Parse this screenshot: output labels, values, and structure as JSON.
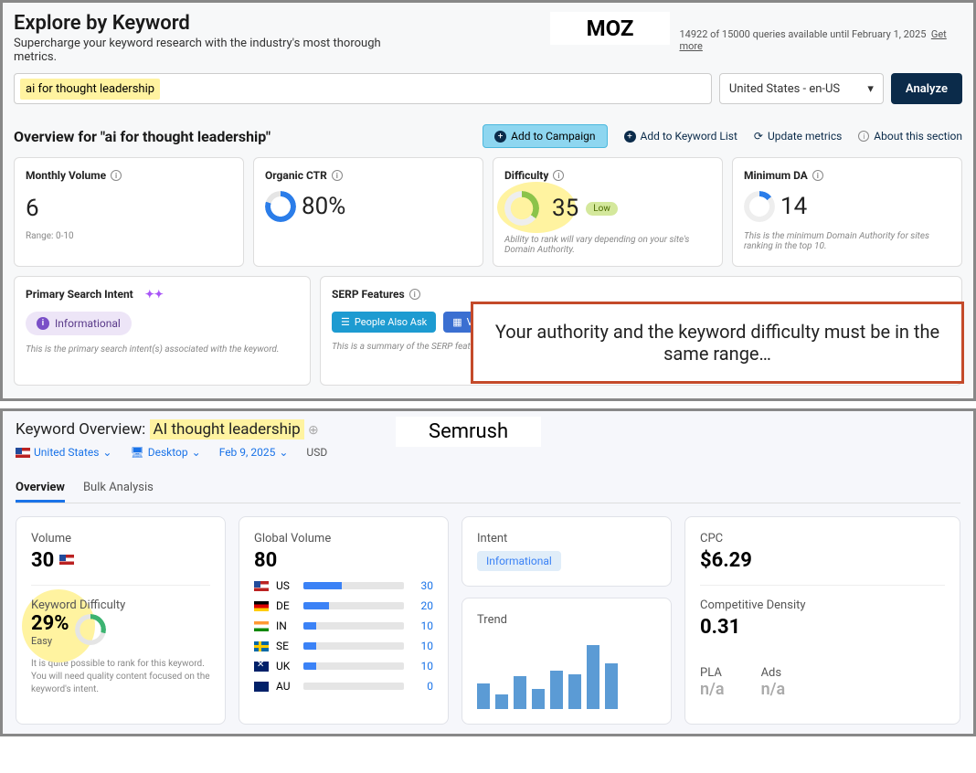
{
  "moz": {
    "title": "Explore by Keyword",
    "subtitle": "Supercharge your keyword research with the industry's most thorough metrics.",
    "brand": "MOZ",
    "quota": "14922 of 15000 queries available until February 1, 2025",
    "quota_link": "Get more",
    "search_value": "ai for thought leadership",
    "locale": "United States - en-US",
    "analyze": "Analyze",
    "overview_title": "Overview for \"ai for thought leadership\"",
    "actions": {
      "campaign": "Add to Campaign",
      "kwlist": "Add to Keyword List",
      "update": "Update metrics",
      "about": "About this section"
    },
    "cards": {
      "volume": {
        "label": "Monthly Volume",
        "value": "6",
        "sub": "Range: 0-10"
      },
      "ctr": {
        "label": "Organic CTR",
        "value": "80%"
      },
      "diff": {
        "label": "Difficulty",
        "value": "35",
        "badge": "Low",
        "sub": "Ability to rank will vary depending on your site's Domain Authority."
      },
      "minda": {
        "label": "Minimum DA",
        "value": "14",
        "sub": "This is the minimum Domain Authority for sites ranking in the top 10."
      }
    },
    "intent": {
      "label": "Primary Search Intent",
      "value": "Informational",
      "sub": "This is the primary search intent(s) associated with the keyword."
    },
    "serp": {
      "label": "SERP Features",
      "pills": [
        "People Also Ask",
        "V"
      ],
      "sub": "This is a summary of the SERP feature"
    }
  },
  "callout": "Your authority and the keyword difficulty must be in the same range…",
  "semrush": {
    "title_prefix": "Keyword Overview:",
    "keyword": "AI thought leadership",
    "brand": "Semrush",
    "filters": {
      "country": "United States",
      "device": "Desktop",
      "date": "Feb 9, 2025",
      "currency": "USD"
    },
    "tabs": {
      "overview": "Overview",
      "bulk": "Bulk Analysis"
    },
    "volume": {
      "label": "Volume",
      "value": "30"
    },
    "kd": {
      "label": "Keyword Difficulty",
      "value": "29%",
      "easy": "Easy",
      "note": "It is quite possible to rank for this keyword. You will need quality content focused on the keyword's intent."
    },
    "global": {
      "label": "Global Volume",
      "value": "80",
      "rows": [
        {
          "cc": "US",
          "flag": "flag-us",
          "val": 30,
          "pct": 38
        },
        {
          "cc": "DE",
          "flag": "flag-de",
          "val": 20,
          "pct": 25
        },
        {
          "cc": "IN",
          "flag": "flag-in",
          "val": 10,
          "pct": 13
        },
        {
          "cc": "SE",
          "flag": "flag-se",
          "val": 10,
          "pct": 13
        },
        {
          "cc": "UK",
          "flag": "flag-uk",
          "val": 10,
          "pct": 13
        },
        {
          "cc": "AU",
          "flag": "flag-au",
          "val": 0,
          "pct": 0
        }
      ]
    },
    "intent": {
      "label": "Intent",
      "value": "Informational"
    },
    "trend": {
      "label": "Trend",
      "bars": [
        28,
        16,
        36,
        22,
        42,
        38,
        70,
        50
      ]
    },
    "cpc": {
      "label": "CPC",
      "value": "$6.29"
    },
    "density": {
      "label": "Competitive Density",
      "value": "0.31"
    },
    "pla": {
      "label": "PLA",
      "value": "n/a"
    },
    "ads": {
      "label": "Ads",
      "value": "n/a"
    }
  }
}
